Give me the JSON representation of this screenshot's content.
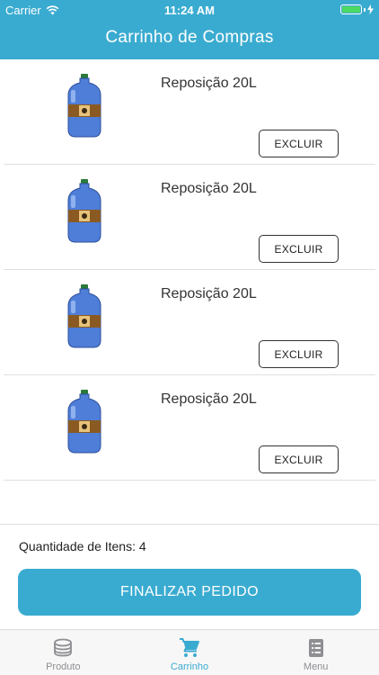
{
  "status": {
    "carrier": "Carrier",
    "time": "11:24 AM"
  },
  "header": {
    "title": "Carrinho de Compras"
  },
  "cart": {
    "items": [
      {
        "name": "Reposição 20L",
        "delete_label": "EXCLUIR"
      },
      {
        "name": "Reposição 20L",
        "delete_label": "EXCLUIR"
      },
      {
        "name": "Reposição 20L",
        "delete_label": "EXCLUIR"
      },
      {
        "name": "Reposição 20L",
        "delete_label": "EXCLUIR"
      }
    ]
  },
  "summary": {
    "item_count_text": "Quantidade de Itens: 4"
  },
  "checkout": {
    "label": "FINALIZAR PEDIDO"
  },
  "tabs": [
    {
      "label": "Produto",
      "icon": "coins-stack-icon",
      "active": false
    },
    {
      "label": "Carrinho",
      "icon": "cart-icon",
      "active": true
    },
    {
      "label": "Menu",
      "icon": "menu-list-icon",
      "active": false
    }
  ],
  "colors": {
    "accent": "#3aabd0",
    "battery": "#4cd964",
    "inactive_tab": "#8e8e93"
  }
}
